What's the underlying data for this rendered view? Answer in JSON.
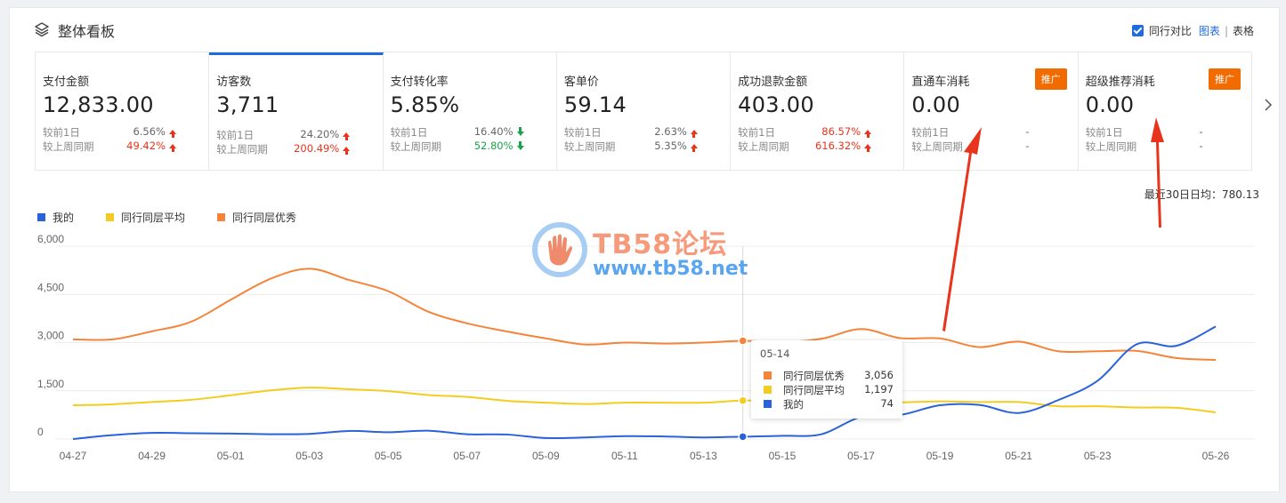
{
  "header": {
    "title": "整体看板",
    "compare_label": "同行对比",
    "view_chart": "图表",
    "separator": "|",
    "view_table": "表格"
  },
  "metrics": [
    {
      "label": "支付金额",
      "value": "12,833.00",
      "day_label": "较前1日",
      "day_pct": "6.56%",
      "day_dir": "up",
      "week_label": "较上周同期",
      "week_pct": "49.42%",
      "week_dir": "up",
      "active": false
    },
    {
      "label": "访客数",
      "value": "3,711",
      "day_label": "较前1日",
      "day_pct": "24.20%",
      "day_dir": "up",
      "week_label": "较上周同期",
      "week_pct": "200.49%",
      "week_dir": "up",
      "active": true
    },
    {
      "label": "支付转化率",
      "value": "5.85%",
      "day_label": "较前1日",
      "day_pct": "16.40%",
      "day_dir": "down",
      "week_label": "较上周同期",
      "week_pct": "52.80%",
      "week_dir": "down",
      "active": false
    },
    {
      "label": "客单价",
      "value": "59.14",
      "day_label": "较前1日",
      "day_pct": "2.63%",
      "day_dir": "up",
      "week_label": "较上周同期",
      "week_pct": "5.35%",
      "week_dir": "up",
      "active": false
    },
    {
      "label": "成功退款金额",
      "value": "403.00",
      "day_label": "较前1日",
      "day_pct": "86.57%",
      "day_dir": "up",
      "week_label": "较上周同期",
      "week_pct": "616.32%",
      "week_dir": "up",
      "active": false
    },
    {
      "label": "直通车消耗",
      "value": "0.00",
      "day_label": "较前1日",
      "day_pct": "-",
      "day_dir": "none",
      "week_label": "较上周同期",
      "week_pct": "-",
      "week_dir": "none",
      "promo": "推广",
      "active": false
    },
    {
      "label": "超级推荐消耗",
      "value": "0.00",
      "day_label": "较前1日",
      "day_pct": "-",
      "day_dir": "none",
      "week_label": "较上周同期",
      "week_pct": "-",
      "week_dir": "none",
      "promo": "推广",
      "active": false
    }
  ],
  "avg_text": "最近30日日均：780.13",
  "colors": {
    "mine": "#2a62d9",
    "avg": "#f2cd1f",
    "top": "#f5843a",
    "red": "#e8341c",
    "green": "#1aa34a",
    "accent": "#1f6ae0",
    "promo": "#f26b00",
    "annotation": "#e8341c"
  },
  "chart_data": {
    "type": "line",
    "x": [
      "04-27",
      "04-28",
      "04-29",
      "04-30",
      "05-01",
      "05-02",
      "05-03",
      "05-04",
      "05-05",
      "05-06",
      "05-07",
      "05-08",
      "05-09",
      "05-10",
      "05-11",
      "05-12",
      "05-13",
      "05-14",
      "05-15",
      "05-16",
      "05-17",
      "05-18",
      "05-19",
      "05-20",
      "05-21",
      "05-22",
      "05-23",
      "05-24",
      "05-25",
      "05-26"
    ],
    "x_ticks": [
      "04-27",
      "04-29",
      "05-01",
      "05-03",
      "05-05",
      "05-07",
      "05-09",
      "05-11",
      "05-13",
      "05-15",
      "05-17",
      "05-19",
      "05-21",
      "05-23",
      "05-26"
    ],
    "ylim": [
      0,
      6000
    ],
    "y_ticks": [
      "6,000",
      "4,500",
      "3,000",
      "1,500",
      "0"
    ],
    "y_values": [
      6000,
      4500,
      3000,
      1500,
      0
    ],
    "grid": true,
    "legend": "top-left",
    "series": [
      {
        "name": "我的",
        "color": "#2a62d9",
        "values": [
          0,
          120,
          190,
          180,
          170,
          150,
          160,
          250,
          210,
          260,
          150,
          140,
          30,
          50,
          90,
          80,
          50,
          74,
          100,
          150,
          690,
          750,
          1050,
          1060,
          810,
          1210,
          1810,
          2950,
          2900,
          3500
        ]
      },
      {
        "name": "同行同层平均",
        "color": "#f2cd1f",
        "values": [
          1050,
          1080,
          1150,
          1220,
          1360,
          1510,
          1600,
          1550,
          1490,
          1370,
          1310,
          1190,
          1130,
          1090,
          1130,
          1130,
          1130,
          1197,
          1170,
          1140,
          1130,
          1140,
          1170,
          1150,
          1150,
          1020,
          1020,
          980,
          970,
          830
        ]
      },
      {
        "name": "同行同层优秀",
        "color": "#f5843a",
        "values": [
          3100,
          3100,
          3350,
          3650,
          4330,
          4980,
          5300,
          4950,
          4600,
          3970,
          3600,
          3350,
          3130,
          2940,
          3000,
          2970,
          3000,
          3056,
          3020,
          3120,
          3420,
          3140,
          3130,
          2860,
          3030,
          2730,
          2730,
          2740,
          2520,
          2460
        ]
      }
    ]
  },
  "tooltip": {
    "date": "05-14",
    "rows": [
      {
        "name": "同行同层优秀",
        "value": "3,056",
        "color": "#f5843a"
      },
      {
        "name": "同行同层平均",
        "value": "1,197",
        "color": "#f2cd1f"
      },
      {
        "name": "我的",
        "value": "74",
        "color": "#2a62d9"
      }
    ]
  },
  "watermark": {
    "title": "TB58论坛",
    "url": "www.tb58.net"
  }
}
